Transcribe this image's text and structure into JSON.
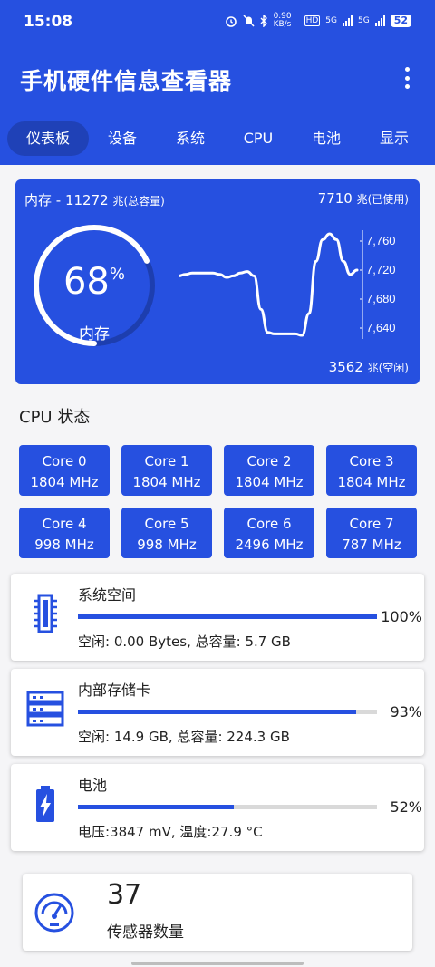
{
  "status_bar": {
    "time": "15:08",
    "net_speed": "0.90 KB/s",
    "hd": "HD",
    "sig1": "5G",
    "sig2": "5G",
    "battery": "52"
  },
  "app_bar": {
    "title": "手机硬件信息查看器"
  },
  "tabs": [
    {
      "label": "仪表板",
      "active": true
    },
    {
      "label": "设备",
      "active": false
    },
    {
      "label": "系统",
      "active": false
    },
    {
      "label": "CPU",
      "active": false
    },
    {
      "label": "电池",
      "active": false
    },
    {
      "label": "显示",
      "active": false
    }
  ],
  "memory": {
    "total_prefix": "内存 - 11272",
    "total_unit": "兆(总容量)",
    "used_value": "7710",
    "used_unit": "兆(已使用)",
    "free_value": "3562",
    "free_unit": "兆(空闲)",
    "percent": "68",
    "percent_sign": "%",
    "gauge_label": "内存",
    "gauge_fraction": 0.68,
    "chart_data": {
      "type": "line",
      "series": [
        {
          "values": [
            7712,
            7714,
            7716,
            7716,
            7716,
            7716,
            7714,
            7710,
            7712,
            7716,
            7718,
            7712,
            7666,
            7634,
            7632,
            7632,
            7632,
            7632,
            7630,
            7660,
            7732,
            7762,
            7770,
            7762,
            7732,
            7714,
            7720
          ]
        }
      ],
      "yticks": [
        "7,760",
        "7,720",
        "7,680",
        "7,640"
      ],
      "ylim": [
        7625,
        7775
      ]
    }
  },
  "cpu_section": {
    "title": "CPU 状态",
    "cores": [
      {
        "name": "Core 0",
        "freq": "1804 MHz"
      },
      {
        "name": "Core 1",
        "freq": "1804 MHz"
      },
      {
        "name": "Core 2",
        "freq": "1804 MHz"
      },
      {
        "name": "Core 3",
        "freq": "1804 MHz"
      },
      {
        "name": "Core 4",
        "freq": "998 MHz"
      },
      {
        "name": "Core 5",
        "freq": "998 MHz"
      },
      {
        "name": "Core 6",
        "freq": "2496 MHz"
      },
      {
        "name": "Core 7",
        "freq": "787 MHz"
      }
    ]
  },
  "storage": [
    {
      "name": "系统空间",
      "percent": "100%",
      "fraction": 1.0,
      "detail": "空闲: 0.00 Bytes, 总容量: 5.7 GB",
      "icon": "ram-chip-icon"
    },
    {
      "name": "内部存储卡",
      "percent": "93%",
      "fraction": 0.93,
      "detail": "空闲: 14.9 GB, 总容量: 224.3 GB",
      "icon": "server-rack-icon"
    },
    {
      "name": "电池",
      "percent": "52%",
      "fraction": 0.52,
      "detail": "电压:3847 mV, 温度:27.9 °C",
      "icon": "battery-charging-icon"
    }
  ],
  "sensors": {
    "count": "37",
    "label": "传感器数量",
    "icon": "sensor-gauge-icon"
  },
  "colors": {
    "primary": "#2650e0",
    "track": "#d9d9d9",
    "background": "#f5f5f7"
  }
}
